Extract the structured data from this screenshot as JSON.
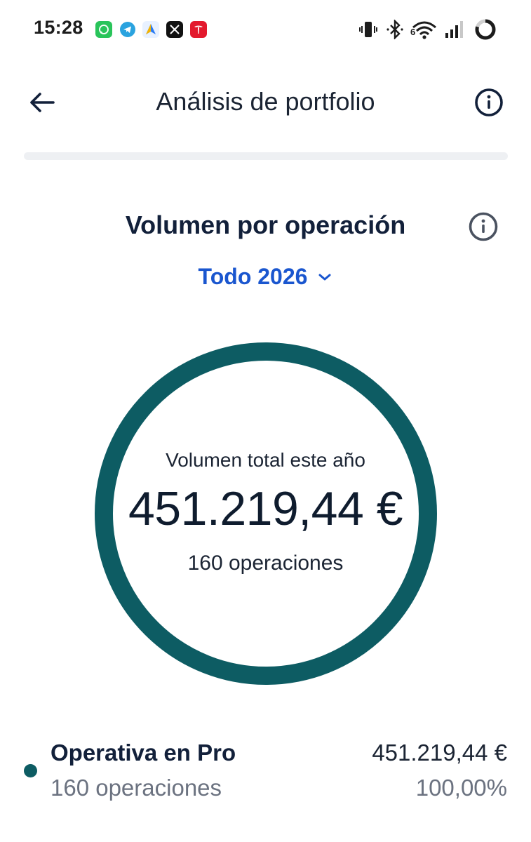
{
  "status_bar": {
    "time": "15:28",
    "notifications": [
      "whatsapp-icon",
      "telegram-icon",
      "maps-navigation-icon",
      "x-icon",
      "tesla-icon"
    ],
    "system_icons": [
      "vibrate-icon",
      "bluetooth-icon",
      "wifi-icon",
      "signal-icon",
      "battery-icon"
    ],
    "wifi_badge": "6"
  },
  "header": {
    "title": "Análisis de portfolio"
  },
  "section": {
    "title": "Volumen por operación",
    "period": "Todo 2026"
  },
  "summary": {
    "label": "Volumen total este año",
    "total": "451.219,44 €",
    "count": "160 operaciones"
  },
  "chart_data": {
    "type": "pie",
    "categories": [
      "Operativa en Pro"
    ],
    "values": [
      451219.44
    ],
    "percentages": [
      100.0
    ],
    "colors": [
      "#0d5c63"
    ]
  },
  "legend": [
    {
      "name": "Operativa en Pro",
      "count": "160 operaciones",
      "amount": "451.219,44 €",
      "percent": "100,00%"
    }
  ],
  "colors": {
    "accent": "#1a56cf",
    "series": "#0d5c63",
    "text": "#12203a"
  }
}
